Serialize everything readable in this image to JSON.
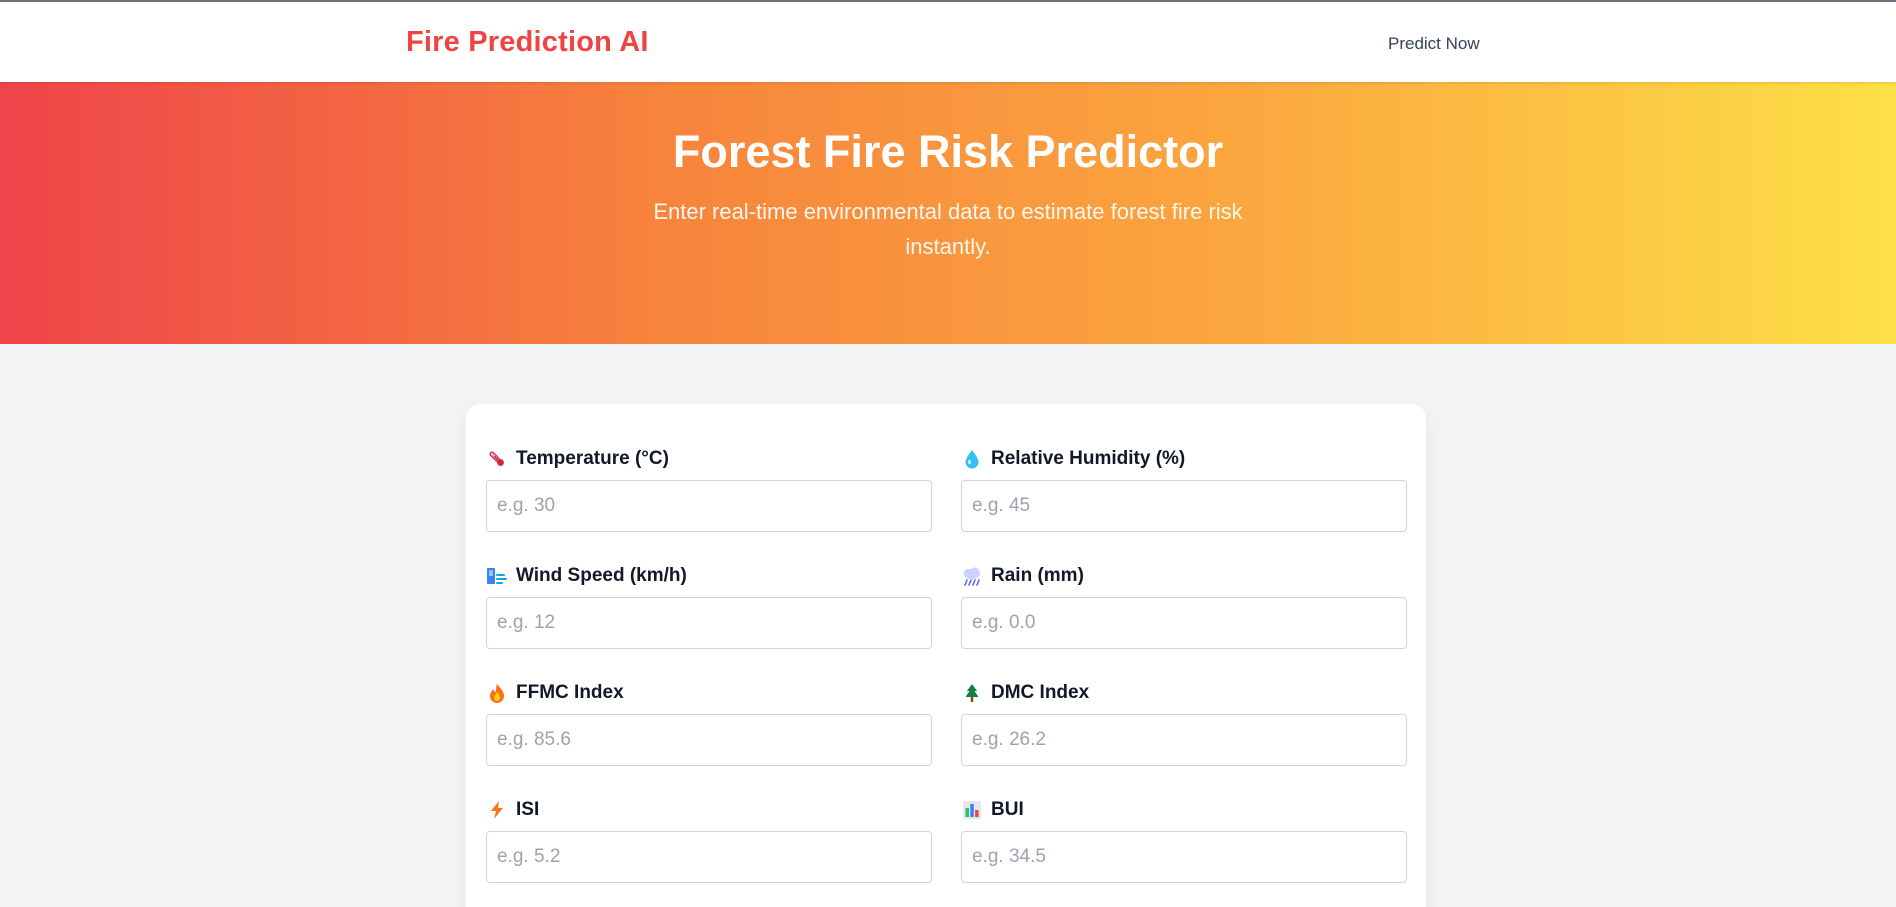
{
  "navbar": {
    "brand": "Fire Prediction AI",
    "link": "Predict Now"
  },
  "hero": {
    "title": "Forest Fire Risk Predictor",
    "subtitle": "Enter real-time environmental data to estimate forest fire risk instantly."
  },
  "form": {
    "fields": [
      {
        "icon": "thermometer-icon",
        "label": "Temperature (°C)",
        "placeholder": "e.g. 30",
        "value": ""
      },
      {
        "icon": "droplet-icon",
        "label": "Relative Humidity (%)",
        "placeholder": "e.g. 45",
        "value": ""
      },
      {
        "icon": "wind-icon",
        "label": "Wind Speed (km/h)",
        "placeholder": "e.g. 12",
        "value": ""
      },
      {
        "icon": "rain-cloud-icon",
        "label": "Rain (mm)",
        "placeholder": "e.g. 0.0",
        "value": ""
      },
      {
        "icon": "fire-icon",
        "label": "FFMC Index",
        "placeholder": "e.g. 85.6",
        "value": ""
      },
      {
        "icon": "tree-icon",
        "label": "DMC Index",
        "placeholder": "e.g. 26.2",
        "value": ""
      },
      {
        "icon": "lightning-icon",
        "label": "ISI",
        "placeholder": "e.g. 5.2",
        "value": ""
      },
      {
        "icon": "bar-chart-icon",
        "label": "BUI",
        "placeholder": "e.g. 34.5",
        "value": ""
      }
    ]
  },
  "colors": {
    "brand": "#ef4444",
    "hero_start": "#ef444a",
    "hero_end": "#fde047",
    "page_bg": "#f3f4f6"
  }
}
